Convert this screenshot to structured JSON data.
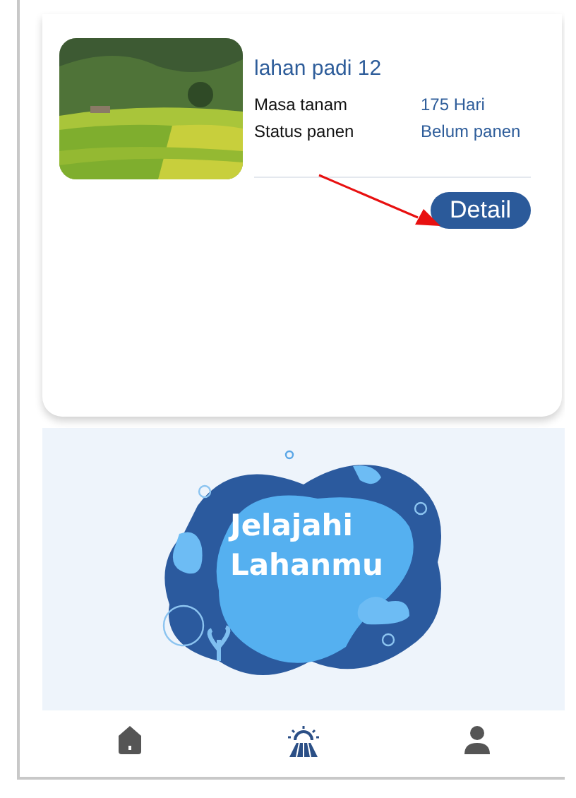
{
  "field_card": {
    "name": "lahan padi 12",
    "rows": [
      {
        "label": "Masa tanam",
        "value": "175 Hari"
      },
      {
        "label": "Status panen",
        "value": "Belum panen"
      }
    ],
    "button": "Detail"
  },
  "banner": {
    "lines": [
      "Jelajahi",
      "Lahanmu"
    ]
  },
  "nav": [
    {
      "kind": "home",
      "selected": false
    },
    {
      "kind": "field",
      "selected": true
    },
    {
      "kind": "profile",
      "selected": false
    }
  ]
}
